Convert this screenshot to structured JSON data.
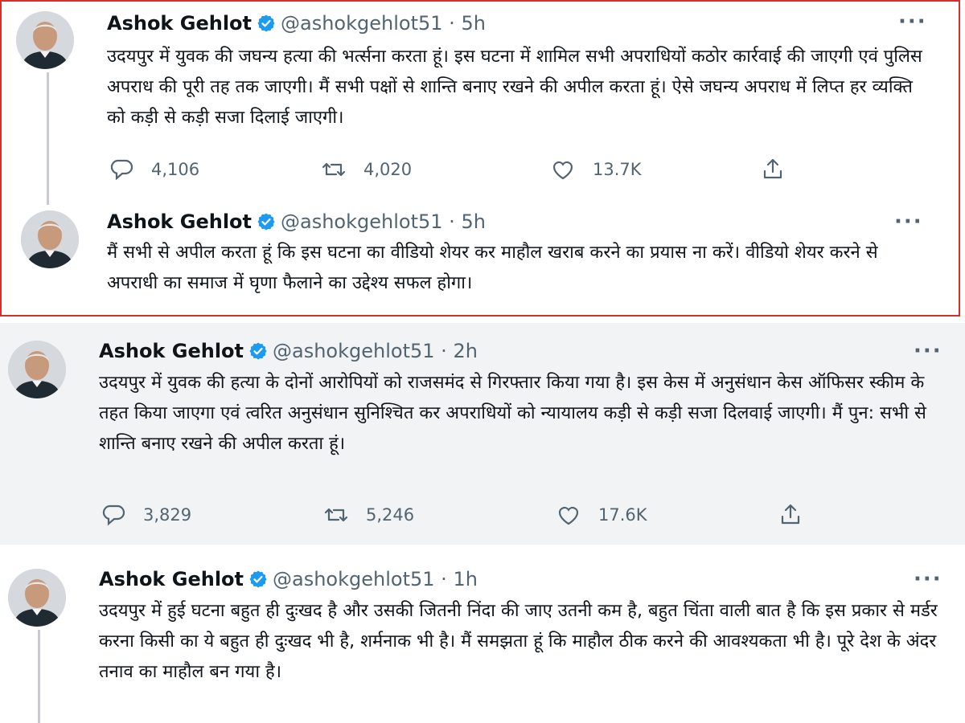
{
  "tweets": [
    {
      "name": "Ashok Gehlot",
      "handle": "@ashokgehlot51",
      "separator": "·",
      "time": "5h",
      "text": "उदयपुर में युवक की जघन्य हत्या की भर्त्सना करता हूं। इस घटना में शामिल सभी अपराधियों कठोर कार्रवाई की जाएगी एवं पुलिस अपराध की पूरी तह तक जाएगी। मैं सभी पक्षों से शान्ति बनाए रखने की अपील करता हूं। ऐसे जघन्य अपराध में लिप्त हर व्यक्ति को कड़ी से कड़ी सजा दिलाई जाएगी।",
      "replies": "4,106",
      "retweets": "4,020",
      "likes": "13.7K"
    },
    {
      "name": "Ashok Gehlot",
      "handle": "@ashokgehlot51",
      "separator": "·",
      "time": "5h",
      "text": "मैं सभी से अपील करता हूं कि इस घटना का वीडियो शेयर कर माहौल खराब करने का प्रयास ना करें। वीडियो शेयर करने से अपराधी का समाज में घृणा फैलाने का उद्देश्य सफल होगा।"
    },
    {
      "name": "Ashok Gehlot",
      "handle": "@ashokgehlot51",
      "separator": "·",
      "time": "2h",
      "text": "उदयपुर में युवक की हत्या के दोनों आरोपियों को राजसमंद से गिरफ्तार किया गया है। इस केस में अनुसंधान केस ऑफिसर स्कीम के तहत किया जाएगा एवं त्वरित अनुसंधान सुनिश्चित कर अपराधियों को न्यायालय कड़ी से कड़ी सजा दिलवाई जाएगी। मैं पुन: सभी से शान्ति बनाए रखने की अपील करता हूं।",
      "replies": "3,829",
      "retweets": "5,246",
      "likes": "17.6K"
    },
    {
      "name": "Ashok Gehlot",
      "handle": "@ashokgehlot51",
      "separator": "·",
      "time": "1h",
      "text": "उदयपुर में हुई घटना बहुत ही दुःखद है और उसकी जितनी निंदा की जाए उतनी कम है, बहुत चिंता वाली बात है कि इस प्रकार से मर्डर करना किसी का ये बहुत ही दुःखद भी है, शर्मनाक भी है। मैं समझता हूं कि माहौल ठीक करने की आवश्यकता भी है। पूरे देश के अंदर तनाव का माहौल बन गया है।"
    }
  ],
  "colors": {
    "highlight_border": "#d32f2f",
    "verified_blue": "#1d9bf0",
    "muted_text": "#536471",
    "panel_gray": "#f2f3f4"
  },
  "icons": [
    "verified-badge-icon",
    "more-icon",
    "reply-icon",
    "retweet-icon",
    "like-icon",
    "share-icon"
  ]
}
